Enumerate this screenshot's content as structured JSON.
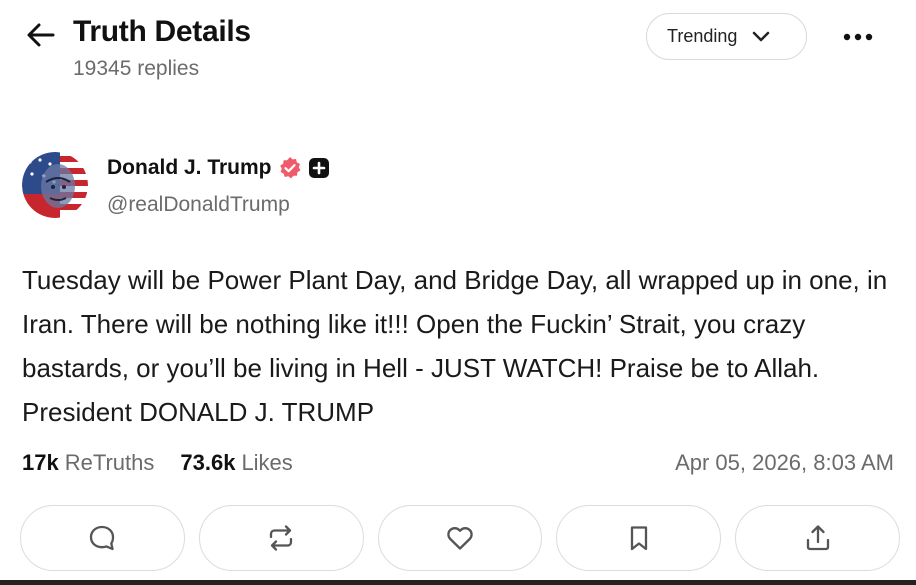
{
  "header": {
    "title": "Truth Details",
    "reply_count": "19345 replies",
    "back_icon": "arrow-left-icon",
    "sort": {
      "selected": "Trending",
      "icon": "chevron-down-icon"
    },
    "more_icon": "more-horizontal-icon"
  },
  "post": {
    "author": {
      "name": "Donald J. Trump",
      "handle": "@realDonaldTrump",
      "verified_icon": "verified-badge-icon",
      "verified_color": "#ef5b6b",
      "plus_icon": "truth-plus-icon"
    },
    "text": "Tuesday will be Power Plant Day, and Bridge Day, all wrapped up in one, in Iran. There will be nothing like it!!! Open the Fuckin’ Strait, you crazy bastards, or you’ll be living in Hell - JUST WATCH! Praise be to Allah. President DONALD J. TRUMP",
    "stats": {
      "retruths_count": "17k",
      "retruths_label": "ReTruths",
      "likes_count": "73.6k",
      "likes_label": "Likes"
    },
    "timestamp": "Apr 05, 2026, 8:03 AM"
  },
  "actions": [
    {
      "icon": "reply-icon"
    },
    {
      "icon": "retruth-icon"
    },
    {
      "icon": "like-icon"
    },
    {
      "icon": "bookmark-icon"
    },
    {
      "icon": "share-icon"
    }
  ]
}
